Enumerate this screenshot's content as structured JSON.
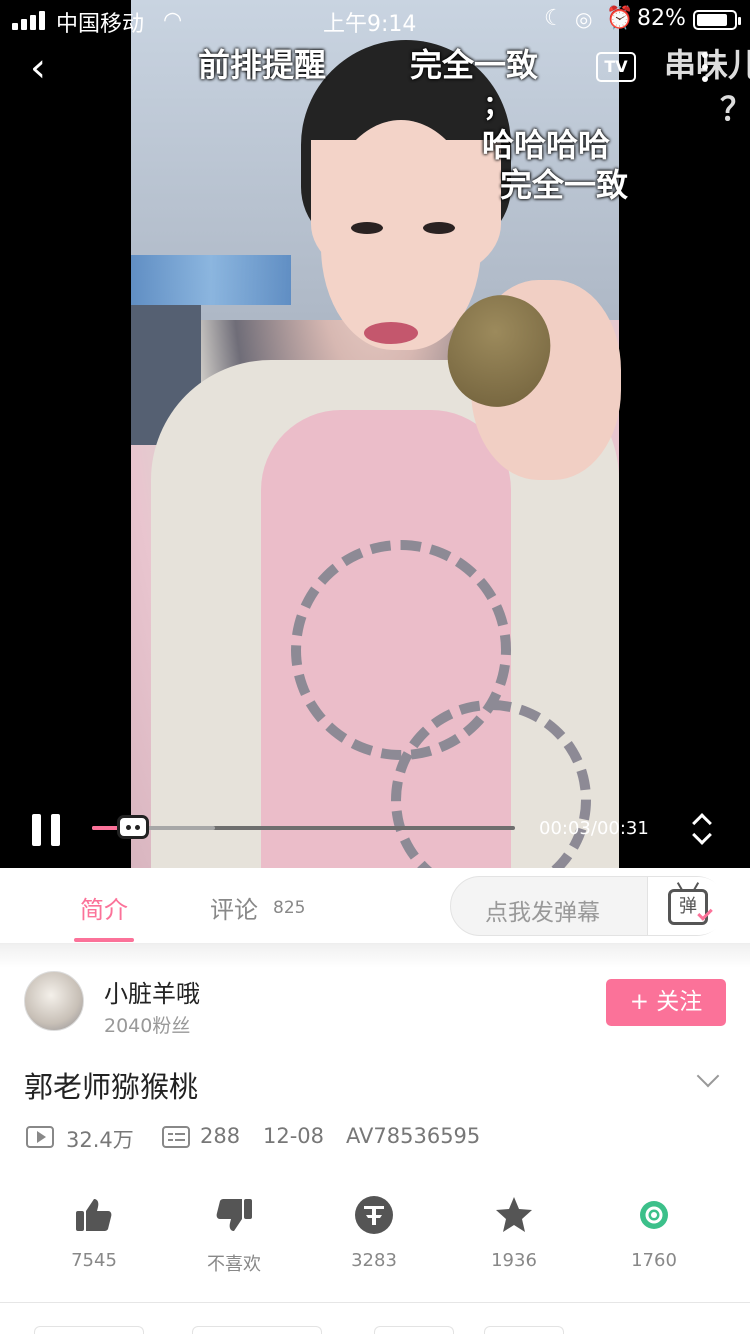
{
  "status_bar": {
    "carrier": "中国移动",
    "time": "上午9:14",
    "battery_percent": "82%",
    "battery_level": 0.82
  },
  "video": {
    "danmaku": [
      "前排提醒",
      "完全一致",
      "；",
      "哈哈哈哈",
      "完全一致",
      "串味儿",
      "？"
    ],
    "tv_label": "TV",
    "time_label": "00:03/00:31",
    "played_fraction": 0.0968,
    "buffered_fraction": 0.29
  },
  "tabs": {
    "intro": "简介",
    "comments": "评论",
    "comments_count": "825",
    "danmaku_placeholder": "点我发弹幕",
    "danmaku_toggle": "弹"
  },
  "uploader": {
    "name": "小脏羊哦",
    "fans": "2040粉丝",
    "follow_label": "+ 关注"
  },
  "info": {
    "title": "郭老师猕猴桃",
    "views": "32.4万",
    "danmaku_count": "288",
    "date": "12-08",
    "av_id": "AV78536595"
  },
  "actions": [
    {
      "name": "like",
      "label": "7545"
    },
    {
      "name": "dislike",
      "label": "不喜欢"
    },
    {
      "name": "coin",
      "label": "3283"
    },
    {
      "name": "favorite",
      "label": "1936"
    },
    {
      "name": "share",
      "label": "1760"
    }
  ],
  "colors": {
    "accent": "#fb7299",
    "icon_gray": "#555555",
    "share_green": "#3cc08a"
  }
}
